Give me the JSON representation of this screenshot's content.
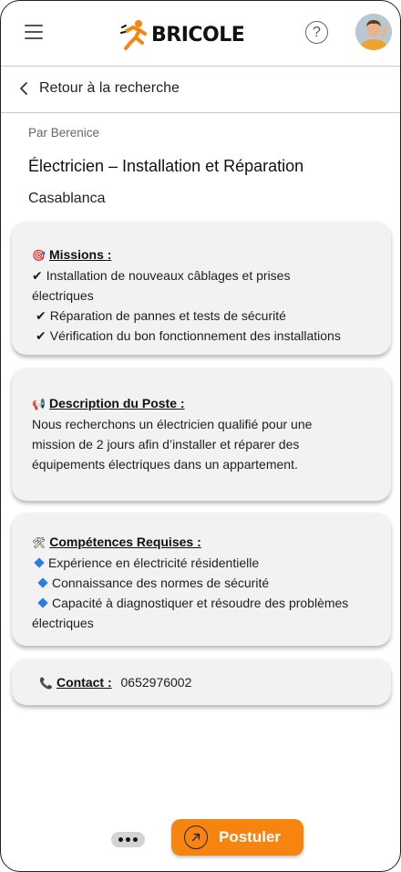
{
  "header": {
    "logo_text": "BRICOLE",
    "help_symbol": "?",
    "icons": [
      "menu-icon",
      "help-icon",
      "avatar"
    ]
  },
  "nav": {
    "back_label": "Retour à la recherche"
  },
  "job": {
    "author": "Par Berenice",
    "title": "Électricien – Installation et Réparation",
    "city": "Casablanca"
  },
  "missions": {
    "heading": "Missions :",
    "items": [
      "Installation de nouveaux câblages et prises",
      "électriques",
      "Réparation de pannes et tests de sécurité",
      "Vérification du bon fonctionnement des installations"
    ]
  },
  "description": {
    "heading": "Description du Poste :",
    "lines": [
      "Nous recherchons un électricien qualifié pour une",
      "mission de 2 jours afin d’installer et réparer des",
      "équipements électriques dans un appartement."
    ]
  },
  "skills": {
    "heading": "Compétences Requises :",
    "items": [
      "Expérience en électricité résidentielle",
      "Connaissance des normes de sécurité",
      "Capacité à diagnostiquer et résoudre des problèmes",
      "électriques"
    ]
  },
  "contact": {
    "heading": "Contact :",
    "phone": "0652976002"
  },
  "footer": {
    "apply_label": "Postuler"
  },
  "colors": {
    "accent": "#f5850f",
    "card": "#f2f2f2",
    "diamond": "#2a7de1"
  }
}
